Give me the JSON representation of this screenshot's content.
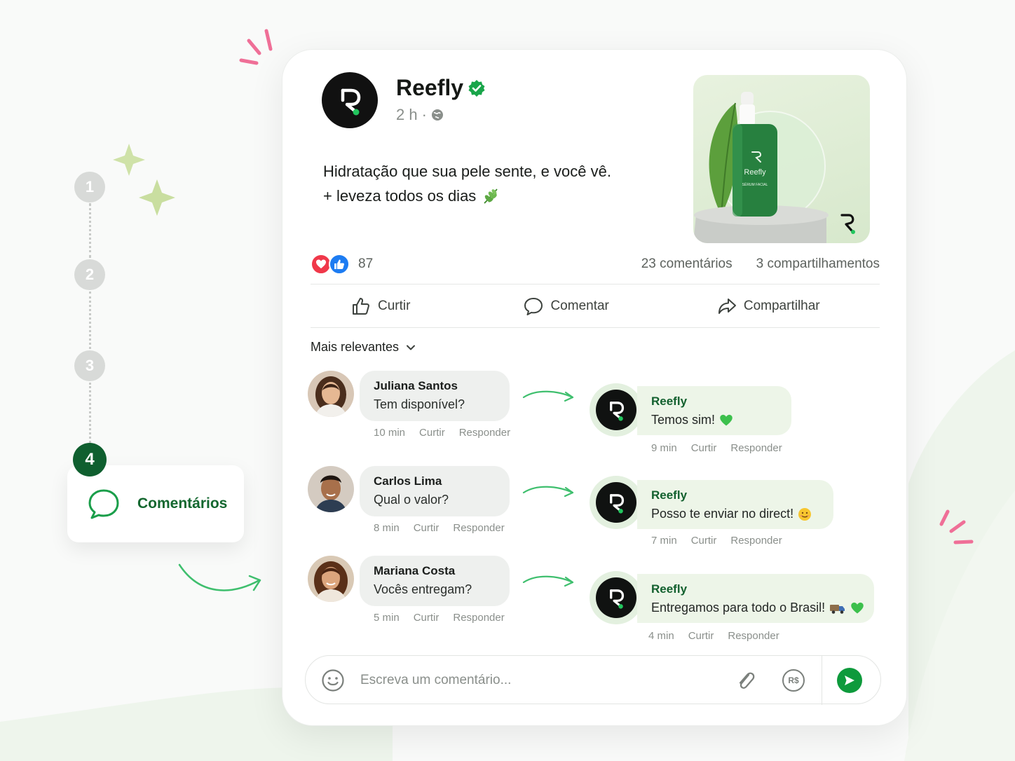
{
  "stepper": {
    "steps": [
      "1",
      "2",
      "3",
      "4"
    ],
    "active_label": "Comentários"
  },
  "post": {
    "brand": "Reefly",
    "time": "2 h",
    "text_line1": "Hidratação que sua pele sente, e você vê.",
    "text_line2": "+ leveza todos os dias",
    "image": {
      "bottle_brand": "Reefly",
      "bottle_product": "SÉRUM FACIAL"
    },
    "reactions_count": "87",
    "comments_count": "23 comentários",
    "shares_count": "3 compartilhamentos"
  },
  "actions": {
    "like": "Curtir",
    "comment": "Comentar",
    "share": "Compartilhar"
  },
  "sort_label": "Mais relevantes",
  "comments": [
    {
      "name": "Juliana Santos",
      "text": "Tem disponível?",
      "time": "10 min",
      "like": "Curtir",
      "reply": "Responder",
      "reply_name": "Reefly",
      "reply_text": "Temos sim!",
      "reply_time": "9 min",
      "reply_like": "Curtir",
      "reply_reply": "Responder"
    },
    {
      "name": "Carlos Lima",
      "text": "Qual o valor?",
      "time": "8 min",
      "like": "Curtir",
      "reply": "Responder",
      "reply_name": "Reefly",
      "reply_text": "Posso te enviar no direct!",
      "reply_time": "7 min",
      "reply_like": "Curtir",
      "reply_reply": "Responder"
    },
    {
      "name": "Mariana Costa",
      "text": "Vocês entregam?",
      "time": "5 min",
      "like": "Curtir",
      "reply": "Responder",
      "reply_name": "Reefly",
      "reply_text": "Entregamos para todo o Brasil!",
      "reply_time": "4 min",
      "reply_like": "Curtir",
      "reply_reply": "Responder"
    }
  ],
  "composer": {
    "placeholder": "Escreva um comentário...",
    "currency_label": "R$"
  },
  "colors": {
    "brand_green": "#0f5f2f",
    "accent_green": "#0e9a3c",
    "love": "#f0384a",
    "like": "#1d7cf2"
  }
}
